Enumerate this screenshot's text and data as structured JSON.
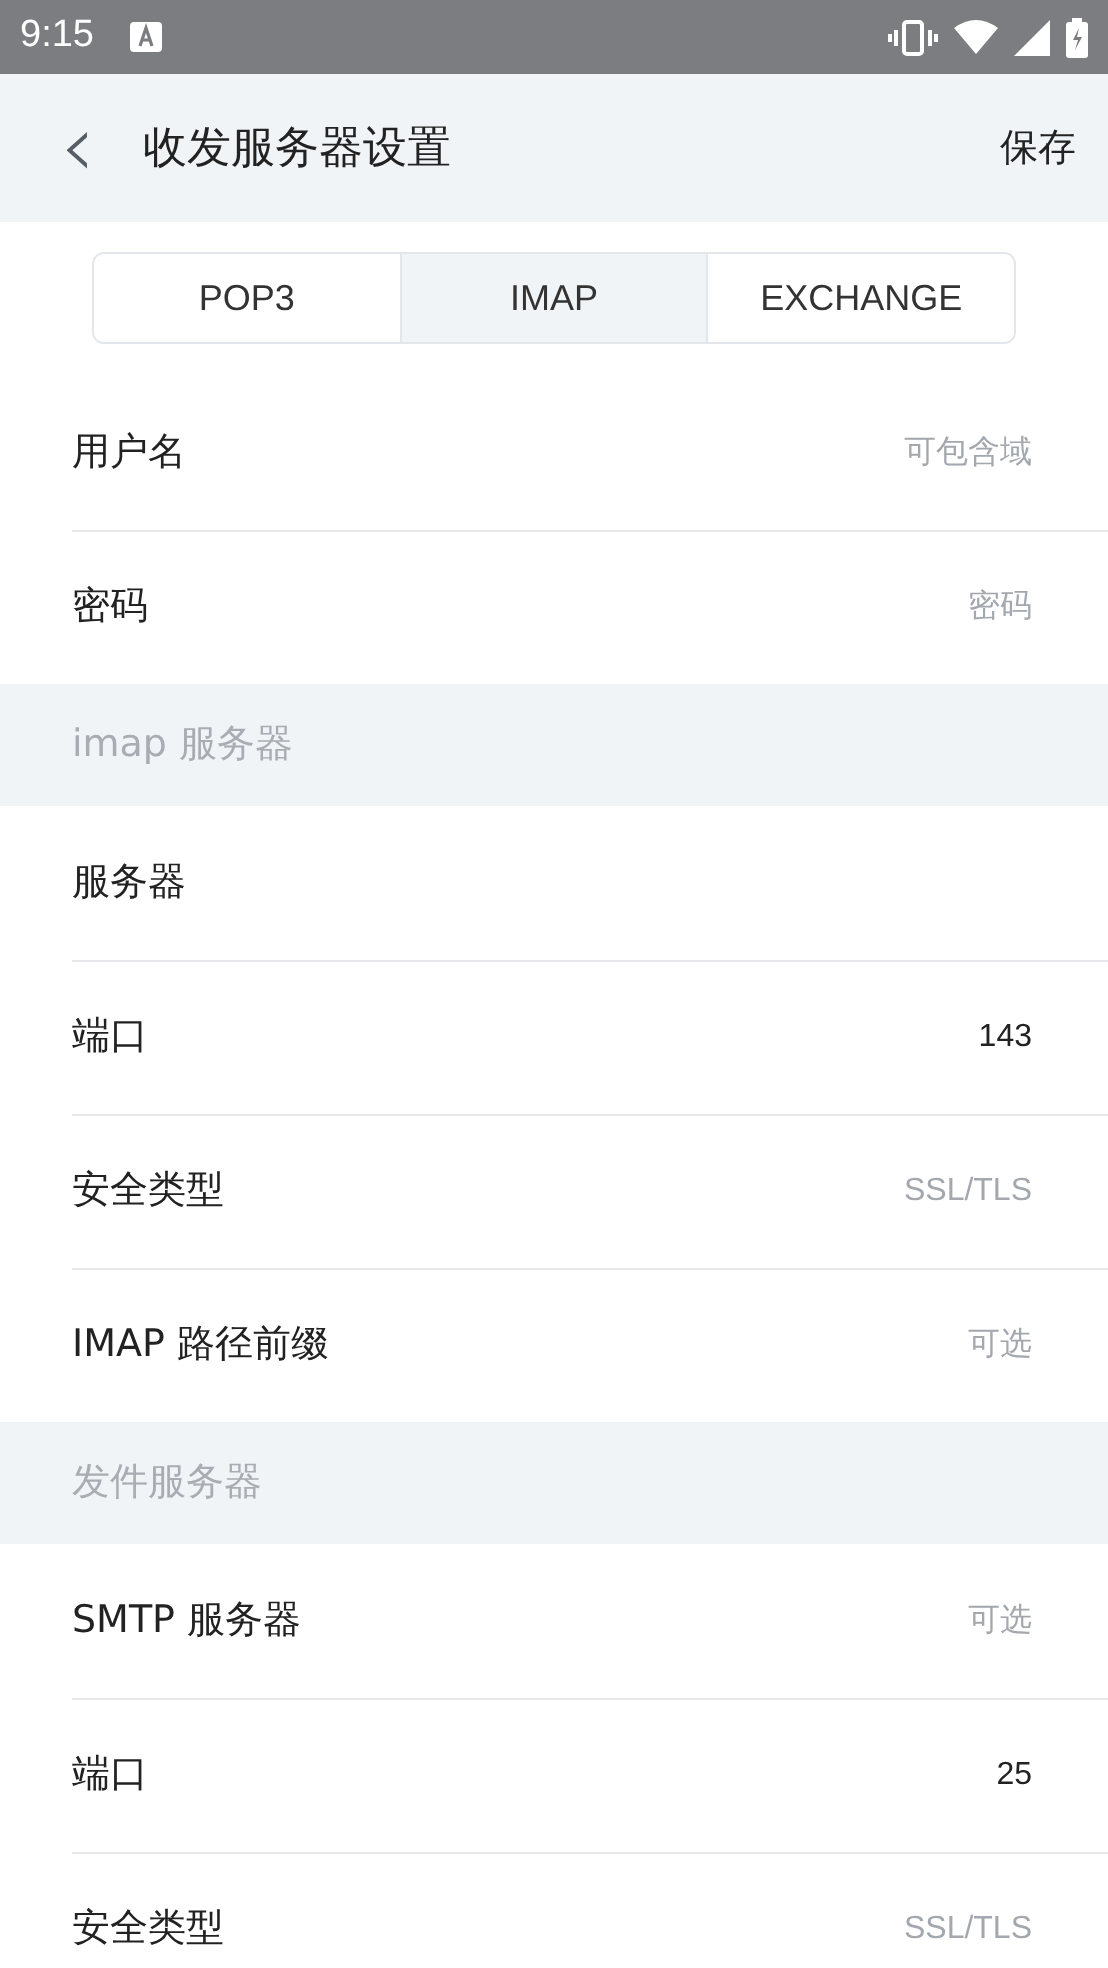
{
  "status_bar": {
    "time": "9:15"
  },
  "header": {
    "back": "‹",
    "title": "收发服务器设置",
    "action": "保存"
  },
  "tabs": [
    {
      "label": "POP3",
      "selected": false
    },
    {
      "label": "IMAP",
      "selected": true
    },
    {
      "label": "EXCHANGE",
      "selected": false
    }
  ],
  "sections": [
    {
      "items": [
        {
          "label": "用户名",
          "placeholder": "可包含域"
        },
        {
          "label": "密码",
          "placeholder": "密码"
        }
      ]
    },
    {
      "title": "imap 服务器",
      "items": [
        {
          "label": "服务器"
        },
        {
          "label": "端口",
          "value": "143"
        },
        {
          "label": "安全类型",
          "placeholder": "SSL/TLS"
        },
        {
          "label": "IMAP 路径前缀",
          "placeholder": "可选"
        }
      ]
    },
    {
      "title": "发件服务器",
      "items": [
        {
          "label": "SMTP 服务器",
          "placeholder": "可选"
        },
        {
          "label": "端口",
          "value": "25"
        },
        {
          "label": "安全类型",
          "placeholder": "SSL/TLS"
        }
      ]
    }
  ]
}
